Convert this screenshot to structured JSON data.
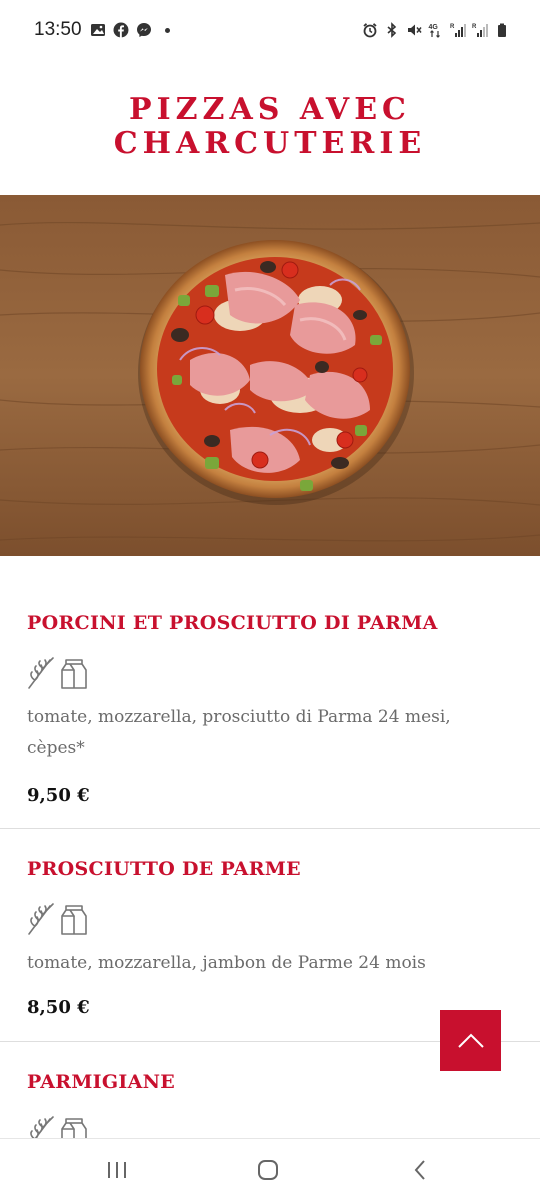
{
  "status_bar": {
    "time": "13:50",
    "left_icons": [
      "gallery-icon",
      "facebook-icon",
      "messenger-icon",
      "notification-dot-icon"
    ],
    "right_icons": [
      "alarm-icon",
      "bluetooth-icon",
      "mute-icon",
      "4g-data-icon",
      "signal-icon",
      "signal-icon",
      "battery-icon"
    ]
  },
  "page": {
    "title": "PIZZAS AVEC CHARCUTERIE"
  },
  "menu": {
    "items": [
      {
        "name": "PORCINI ET PROSCIUTTO DI PARMA",
        "allergens": [
          "gluten-icon",
          "milk-icon"
        ],
        "description": "tomate, mozzarella, prosciutto di Parma 24 mesi, cèpes*",
        "price": "9,50 €"
      },
      {
        "name": "PROSCIUTTO DE PARME",
        "allergens": [
          "gluten-icon",
          "milk-icon"
        ],
        "description": "tomate, mozzarella, jambon de Parme 24 mois",
        "price": "8,50 €"
      },
      {
        "name": "PARMIGIANE",
        "allergens": [
          "gluten-icon",
          "milk-icon"
        ],
        "description": "",
        "price": ""
      }
    ]
  },
  "colors": {
    "accent": "#c8102e",
    "text_muted": "#6b6b6b",
    "divider": "#dedede"
  },
  "nav_bar": {
    "icons": [
      "recent-apps-icon",
      "home-icon",
      "back-icon"
    ]
  }
}
